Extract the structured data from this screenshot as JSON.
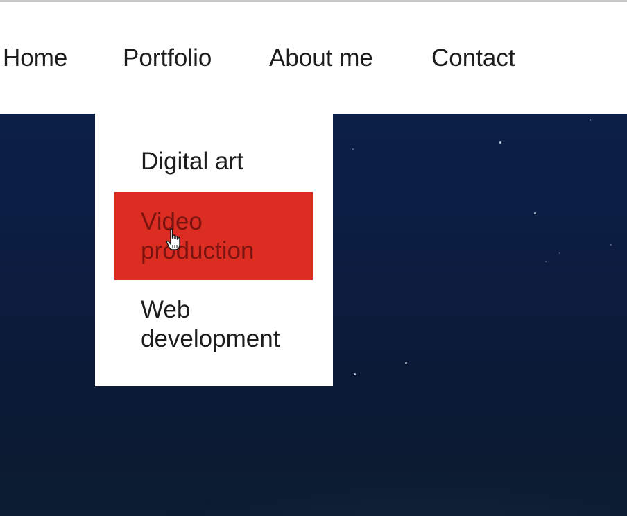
{
  "nav": {
    "items": [
      {
        "label": "Home"
      },
      {
        "label": "Portfolio"
      },
      {
        "label": "About me"
      },
      {
        "label": "Contact"
      }
    ]
  },
  "dropdown": {
    "items": [
      {
        "label": "Digital art",
        "hovered": false
      },
      {
        "label": "Video\nproduction",
        "hovered": true
      },
      {
        "label": "Web\ndevelopment",
        "hovered": false
      }
    ]
  },
  "colors": {
    "highlight": "#dc2d22",
    "hero_background": "#0c1f47",
    "text": "#1c1c1c"
  },
  "icons": {
    "cursor": "hand-pointer-icon"
  }
}
